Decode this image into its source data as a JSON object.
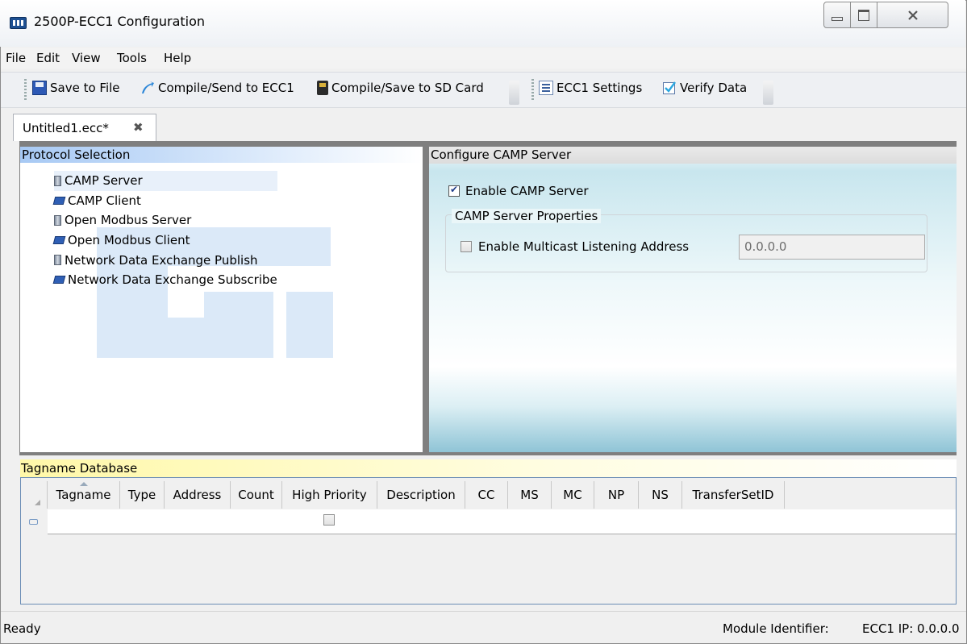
{
  "window": {
    "title": "2500P-ECC1 Configuration"
  },
  "menu": [
    "File",
    "Edit",
    "View",
    "Tools",
    "Help"
  ],
  "toolbar": {
    "save": "Save to File",
    "compile_send": "Compile/Send to ECC1",
    "compile_sd": "Compile/Save to SD Card",
    "settings": "ECC1 Settings",
    "verify": "Verify Data"
  },
  "tab": {
    "label": "Untitled1.ecc*",
    "close_glyph": "✖"
  },
  "protocol": {
    "header": "Protocol Selection",
    "selected_index": 0,
    "items": [
      {
        "label": "CAMP Server",
        "icon": "server-icon"
      },
      {
        "label": "CAMP Client",
        "icon": "client-icon"
      },
      {
        "label": "Open Modbus Server",
        "icon": "server-icon"
      },
      {
        "label": "Open Modbus Client",
        "icon": "client-icon"
      },
      {
        "label": "Network Data Exchange Publish",
        "icon": "server-icon"
      },
      {
        "label": "Network Data Exchange Subscribe",
        "icon": "client-icon"
      }
    ]
  },
  "config": {
    "header": "Configure CAMP Server",
    "enable_label": "Enable CAMP Server",
    "enable_checked": true,
    "properties_legend": "CAMP Server Properties",
    "multicast_label": "Enable Multicast Listening Address",
    "multicast_checked": false,
    "multicast_address": "0.0.0.0"
  },
  "tagdb": {
    "header": "Tagname Database",
    "columns": [
      "Tagname",
      "Type",
      "Address",
      "Count",
      "High Priority",
      "Description",
      "CC",
      "MS",
      "MC",
      "NP",
      "NS",
      "TransferSetID"
    ],
    "sorted_column": "Tagname",
    "new_row_high_priority_checked": false
  },
  "status": {
    "left": "Ready",
    "module_identifier_label": "Module Identifier:",
    "ip": "ECC1 IP: 0.0.0.0"
  }
}
